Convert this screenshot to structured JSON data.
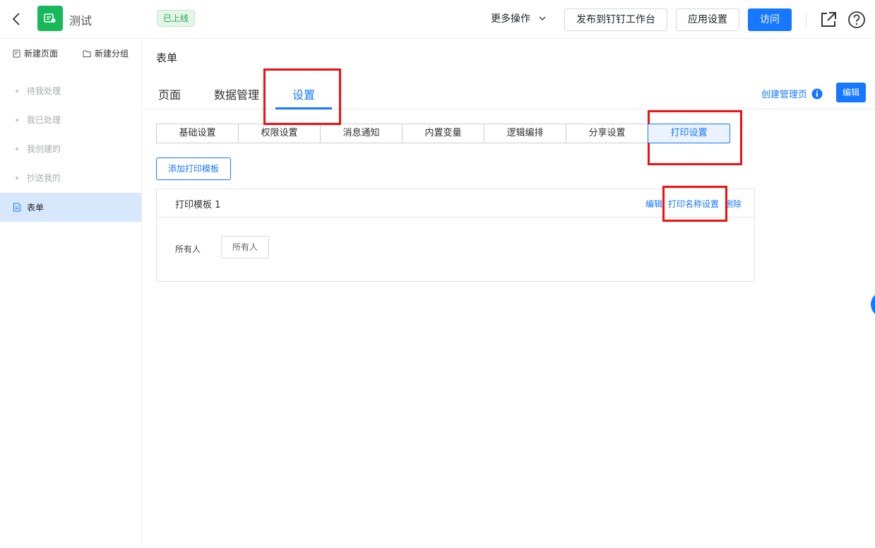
{
  "header": {
    "app_name": "测试",
    "status_badge": "已上线",
    "more_actions": "更多操作",
    "publish_button": "发布到钉钉工作台",
    "app_settings_button": "应用设置",
    "visit_button": "访问"
  },
  "sidebar": {
    "new_page": "新建页面",
    "new_group": "新建分组",
    "items": [
      {
        "label": "待我处理"
      },
      {
        "label": "我已处理"
      },
      {
        "label": "我创建的"
      },
      {
        "label": "抄送我的"
      },
      {
        "label": "表单"
      }
    ]
  },
  "main": {
    "breadcrumb": "表单",
    "tabs": [
      {
        "label": "页面"
      },
      {
        "label": "数据管理"
      },
      {
        "label": "设置"
      }
    ],
    "create_management_page": "创建管理页",
    "edit_button": "编辑",
    "settings_tabs": [
      {
        "label": "基础设置"
      },
      {
        "label": "权限设置"
      },
      {
        "label": "消息通知"
      },
      {
        "label": "内置变量"
      },
      {
        "label": "逻辑编排"
      },
      {
        "label": "分享设置"
      },
      {
        "label": "打印设置"
      }
    ],
    "add_template_button": "添加打印模板",
    "template": {
      "title": "打印模板 1",
      "edit": "编辑",
      "print_name_settings": "打印名称设置",
      "delete": "删除",
      "owner_label": "所有人",
      "owner_value": "所有人"
    }
  },
  "colors": {
    "accent": "#1677ff",
    "logo_bg": "#18b95b",
    "highlight_box": "#f01010",
    "sidebar_active": "#d8e8fc"
  }
}
